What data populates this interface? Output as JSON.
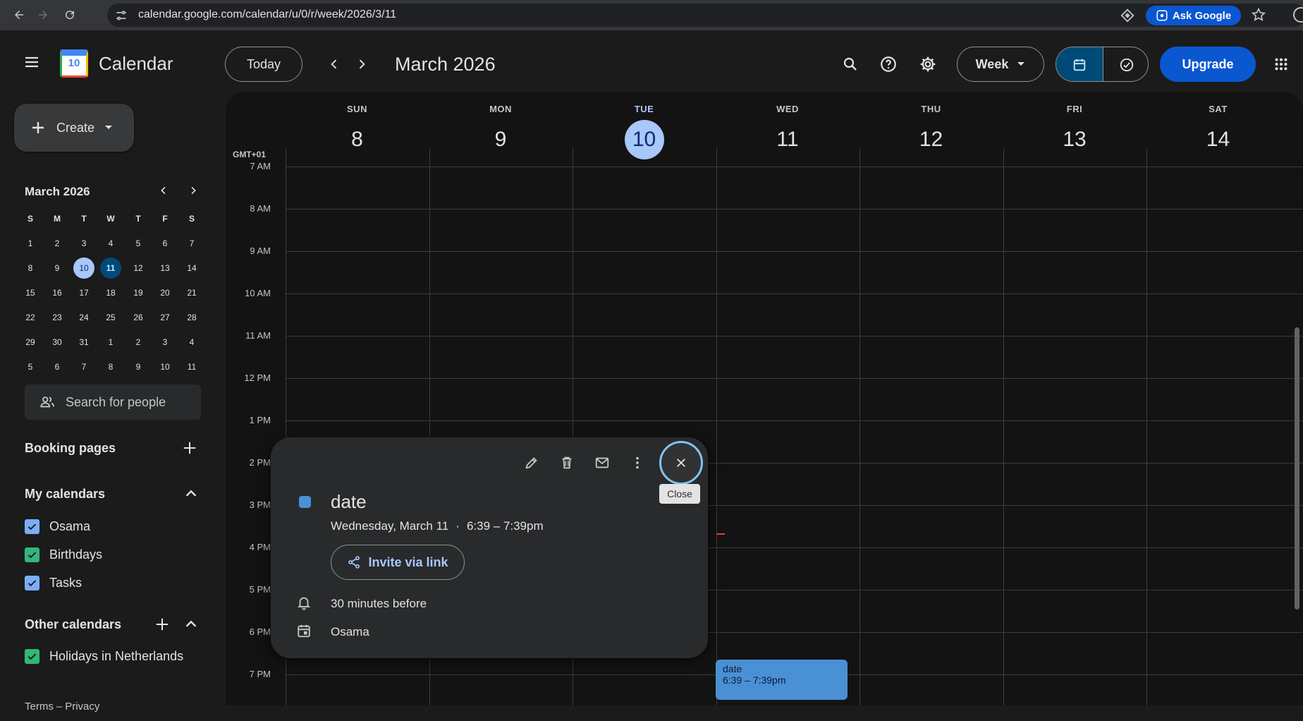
{
  "browser": {
    "url": "calendar.google.com/calendar/u/0/r/week/2026/3/11",
    "ask_google_label": "Ask Google",
    "icons": [
      "back-icon",
      "forward-icon",
      "reload-icon",
      "site-info-icon",
      "lens-icon",
      "star-icon",
      "profile-icon"
    ]
  },
  "header": {
    "app_title": "Calendar",
    "logo_day": "10",
    "today_label": "Today",
    "period_title": "March 2026",
    "view_label": "Week",
    "upgrade_label": "Upgrade"
  },
  "sidebar": {
    "create_label": "Create",
    "mini_month_title": "March 2026",
    "weekday_letters": [
      "S",
      "M",
      "T",
      "W",
      "T",
      "F",
      "S"
    ],
    "mini_days": [
      [
        "1",
        "2",
        "3",
        "4",
        "5",
        "6",
        "7"
      ],
      [
        "8",
        "9",
        "10",
        "11",
        "12",
        "13",
        "14"
      ],
      [
        "15",
        "16",
        "17",
        "18",
        "19",
        "20",
        "21"
      ],
      [
        "22",
        "23",
        "24",
        "25",
        "26",
        "27",
        "28"
      ],
      [
        "29",
        "30",
        "31",
        "1",
        "2",
        "3",
        "4"
      ],
      [
        "5",
        "6",
        "7",
        "8",
        "9",
        "10",
        "11"
      ]
    ],
    "today_day": "10",
    "selected_day": "11",
    "search_people_placeholder": "Search for people",
    "booking_pages_label": "Booking pages",
    "my_calendars_label": "My calendars",
    "my_calendars": [
      {
        "name": "Osama",
        "color": "#7aaef7"
      },
      {
        "name": "Birthdays",
        "color": "#33b679"
      },
      {
        "name": "Tasks",
        "color": "#7aaef7"
      }
    ],
    "other_calendars_label": "Other calendars",
    "other_calendars": [
      {
        "name": "Holidays in Netherlands",
        "color": "#33b679"
      }
    ],
    "footer_terms": "Terms",
    "footer_sep": "–",
    "footer_privacy": "Privacy"
  },
  "grid": {
    "timezone": "GMT+01",
    "days": [
      {
        "name": "SUN",
        "num": "8"
      },
      {
        "name": "MON",
        "num": "9"
      },
      {
        "name": "TUE",
        "num": "10",
        "today": true
      },
      {
        "name": "WED",
        "num": "11"
      },
      {
        "name": "THU",
        "num": "12"
      },
      {
        "name": "FRI",
        "num": "13"
      },
      {
        "name": "SAT",
        "num": "14"
      }
    ],
    "hours": [
      "7 AM",
      "8 AM",
      "9 AM",
      "10 AM",
      "11 AM",
      "12 PM",
      "1 PM",
      "2 PM",
      "3 PM",
      "4 PM",
      "5 PM",
      "6 PM",
      "7 PM"
    ]
  },
  "event": {
    "title": "date",
    "time": "6:39 – 7:39pm"
  },
  "popup": {
    "title": "date",
    "date_line": "Wednesday, March 11",
    "dot": "·",
    "time_line": "6:39 – 7:39pm",
    "invite_label": "Invite via link",
    "reminder": "30 minutes before",
    "calendar_name": "Osama",
    "close_tooltip": "Close",
    "event_color": "#4a90d4"
  },
  "colors": {
    "accent": "#a8c7fa",
    "selected_mini": "#0b57d0",
    "upgrade_bg": "#0b57d0"
  }
}
